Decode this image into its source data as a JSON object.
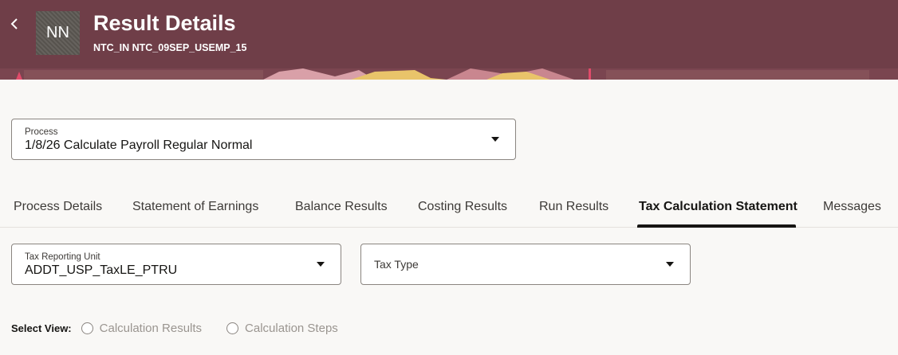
{
  "header": {
    "back_icon": "chevron-left-icon",
    "avatar_initials": "NN",
    "title": "Result Details",
    "subtitle": "NTC_IN NTC_09SEP_USEMP_15",
    "background_color": "#6f3e48"
  },
  "process_select": {
    "label": "Process",
    "value": "1/8/26 Calculate Payroll Regular Normal"
  },
  "tabs": [
    {
      "label": "Process Details",
      "active": false
    },
    {
      "label": "Statement of Earnings",
      "active": false
    },
    {
      "label": "Balance Results",
      "active": false
    },
    {
      "label": "Costing Results",
      "active": false
    },
    {
      "label": "Run Results",
      "active": false
    },
    {
      "label": "Tax Calculation Statement",
      "active": true
    },
    {
      "label": "Messages",
      "active": false
    }
  ],
  "filters": {
    "tax_reporting_unit": {
      "label": "Tax Reporting Unit",
      "value": "ADDT_USP_TaxLE_PTRU"
    },
    "tax_type": {
      "placeholder": "Tax Type"
    }
  },
  "select_view": {
    "label": "Select View:",
    "options": [
      "Calculation Results",
      "Calculation Steps"
    ]
  }
}
